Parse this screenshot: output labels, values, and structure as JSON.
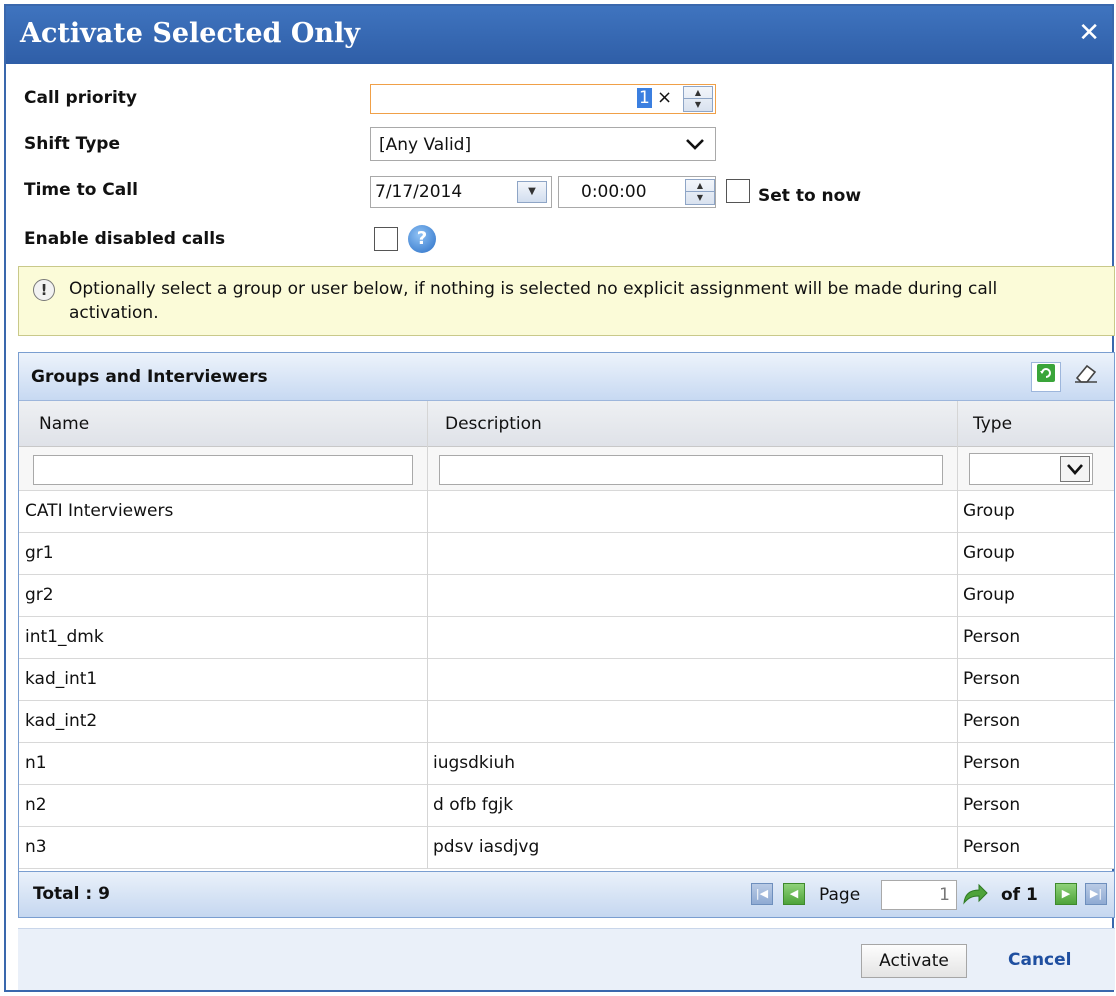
{
  "dialog": {
    "title": "Activate Selected Only",
    "close_glyph": "✕"
  },
  "form": {
    "call_priority": {
      "label": "Call priority",
      "value": "1",
      "clear_glyph": "×"
    },
    "shift_type": {
      "label": "Shift Type",
      "value": "[Any Valid]"
    },
    "time_to_call": {
      "label": "Time to Call",
      "date": "7/17/2014",
      "time": "0:00:00",
      "set_now_label": "Set to now"
    },
    "enable_disabled": {
      "label": "Enable disabled calls"
    }
  },
  "info": {
    "text": "Optionally select a group or user below, if nothing is selected no explicit assignment will be made during call activation."
  },
  "grid": {
    "title": "Groups and Interviewers",
    "columns": {
      "name": "Name",
      "description": "Description",
      "type": "Type"
    },
    "rows": [
      {
        "name": "CATI Interviewers",
        "description": "",
        "type": "Group"
      },
      {
        "name": "gr1",
        "description": "",
        "type": "Group"
      },
      {
        "name": "gr2",
        "description": "",
        "type": "Group"
      },
      {
        "name": "int1_dmk",
        "description": "",
        "type": "Person"
      },
      {
        "name": "kad_int1",
        "description": "",
        "type": "Person"
      },
      {
        "name": "kad_int2",
        "description": "",
        "type": "Person"
      },
      {
        "name": "n1",
        "description": "iugsdkiuh",
        "type": "Person"
      },
      {
        "name": "n2",
        "description": "d ofb fgjk",
        "type": "Person"
      },
      {
        "name": "n3",
        "description": "pdsv iasdjvg",
        "type": "Person"
      }
    ],
    "footer": {
      "total": "Total : 9",
      "page_label": "Page",
      "page_value": "1",
      "of_label": "of 1"
    }
  },
  "buttons": {
    "activate": "Activate",
    "cancel": "Cancel"
  }
}
